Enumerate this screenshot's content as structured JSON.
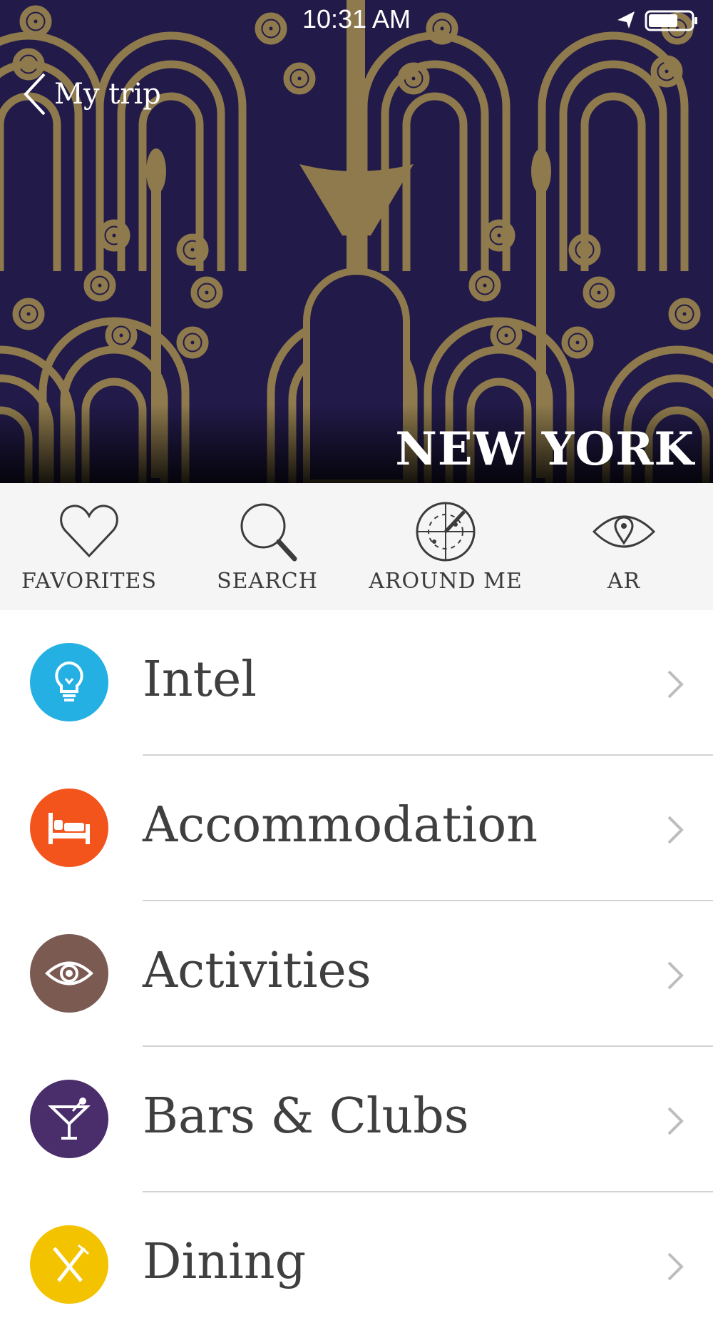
{
  "status_bar": {
    "time": "10:31 AM"
  },
  "header": {
    "back_label": "My trip",
    "city": "NEW YORK"
  },
  "colors": {
    "hero_bg": "#221a48",
    "pattern_gold": "#8e7a4c",
    "intel": "#24b0e3",
    "accommodation": "#f3541b",
    "activities": "#7a5a51",
    "bars_clubs": "#4a2d6b",
    "dining": "#f4c300"
  },
  "quick_actions": [
    {
      "label": "FAVORITES",
      "icon": "heart-icon"
    },
    {
      "label": "SEARCH",
      "icon": "search-icon"
    },
    {
      "label": "AROUND ME",
      "icon": "radar-icon"
    },
    {
      "label": "AR",
      "icon": "eye-pin-icon"
    }
  ],
  "categories": [
    {
      "label": "Intel",
      "icon": "lightbulb-icon"
    },
    {
      "label": "Accommodation",
      "icon": "bed-icon"
    },
    {
      "label": "Activities",
      "icon": "eye-icon"
    },
    {
      "label": "Bars & Clubs",
      "icon": "martini-icon"
    },
    {
      "label": "Dining",
      "icon": "fork-knife-icon"
    }
  ]
}
